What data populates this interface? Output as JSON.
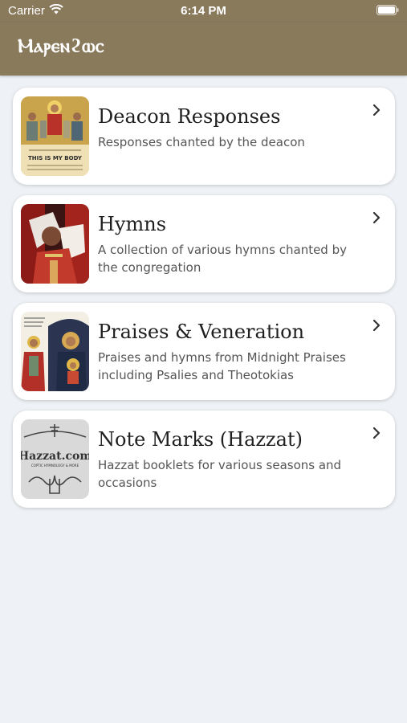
{
  "status_bar": {
    "carrier": "Carrier",
    "time": "6:14 PM",
    "icons": [
      "wifi-icon",
      "battery-icon"
    ]
  },
  "app_bar": {
    "title": "Ⲙⲁⲣⲉⲛϩⲱⲥ",
    "background": "#8a7a5c"
  },
  "items": [
    {
      "title": "Deacon Responses",
      "description": "Responses chanted by the deacon",
      "thumbnail_text": [
        "THIS IS MY BODY"
      ],
      "icon": "chevron-right-icon"
    },
    {
      "title": "Hymns",
      "description": "A collection of various hymns chanted by the congregation",
      "icon": "chevron-right-icon"
    },
    {
      "title": "Praises & Veneration",
      "description": "Praises and hymns from Midnight Praises including Psalies and Theotokias",
      "icon": "chevron-right-icon"
    },
    {
      "title": "Note Marks (Hazzat)",
      "description": "Hazzat booklets for various seasons and occasions",
      "thumbnail_text": [
        "Hazzat.com",
        "COPTIC HYMNOLOGY & MORE"
      ],
      "icon": "chevron-right-icon"
    }
  ],
  "colors": {
    "background": "#eef1f5",
    "card": "#ffffff",
    "title": "#1f1f1f",
    "description": "#555555"
  }
}
